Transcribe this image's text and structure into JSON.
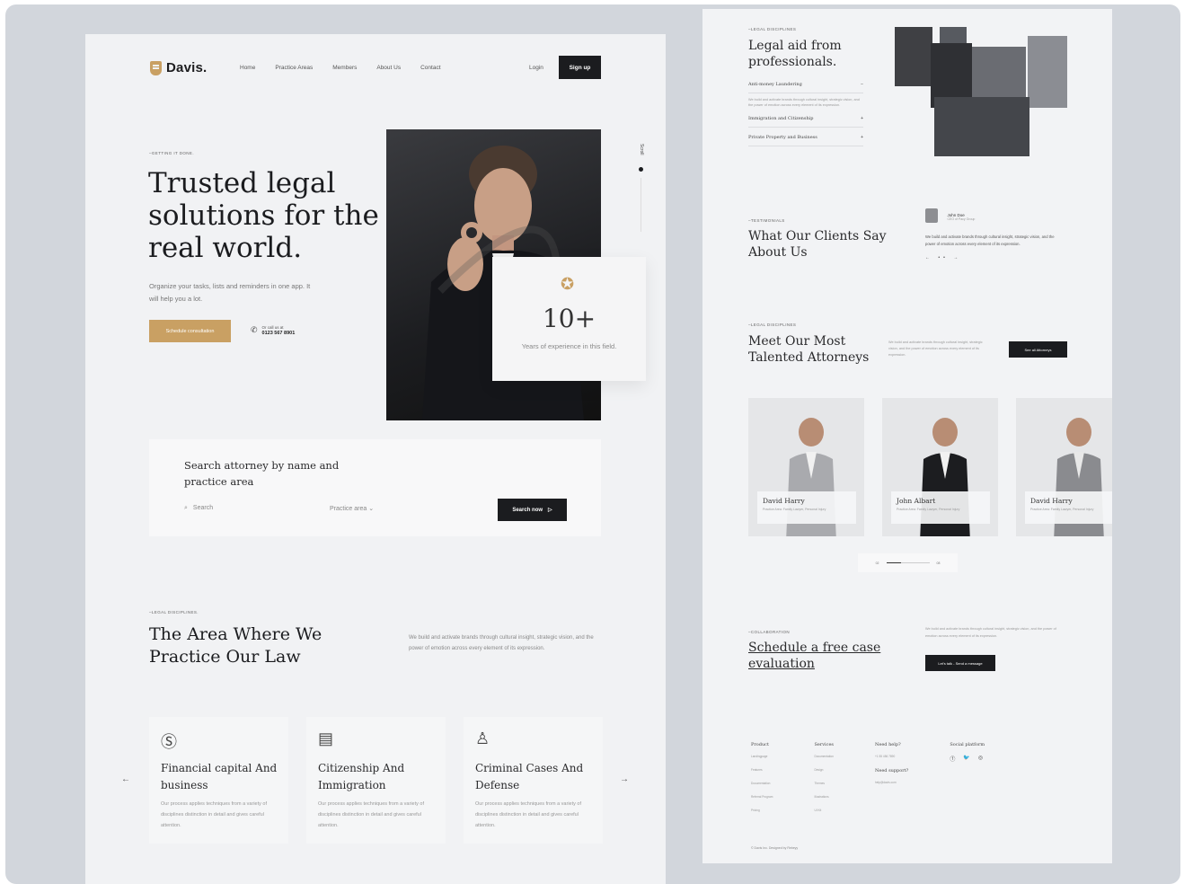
{
  "left": {
    "logo": "Davis.",
    "nav": [
      "Home",
      "Practice Areas",
      "Members",
      "About Us",
      "Contact"
    ],
    "login": "Login",
    "signup": "Sign up",
    "hero": {
      "eyebrow": "–GETTING IT DONE.",
      "title": "Trusted legal solutions for the real world.",
      "desc": "Organize your tasks, lists and reminders in one app. It will help you a lot.",
      "cta": "Schedule consultation",
      "call_label": "Or call us at",
      "call_number": "0123 567 8901",
      "scroll": "Scroll"
    },
    "experience": {
      "number": "10+",
      "label": "Years of experience in this field."
    },
    "search": {
      "title": "Search attorney by name and practice area",
      "placeholder": "Search",
      "area": "Practice area",
      "button": "Search now"
    },
    "practice": {
      "eyebrow": "–LEGAL DISCIPLINES.",
      "title": "The Area Where We Practice Our Law",
      "desc": "We build and activate brands through cultural insight, strategic vision, and the power of emotion across every element of its expression.",
      "cards": [
        {
          "icon": "dollar-icon",
          "title": "Financial capital And business",
          "desc": "Our process applies techniques from a variety of disciplines distinction in detail and gives careful attention."
        },
        {
          "icon": "passport-icon",
          "title": "Citizenship And Immigration",
          "desc": "Our process applies techniques from a variety of disciplines distinction in detail and gives careful attention."
        },
        {
          "icon": "user-shield-icon",
          "title": "Criminal Cases And Defense",
          "desc": "Our process applies techniques from a variety of disciplines distinction in detail and gives careful attention."
        }
      ]
    }
  },
  "right": {
    "legal_aid": {
      "eyebrow": "–LEGAL DISCIPLINES",
      "title": "Legal aid from professionals.",
      "items": [
        {
          "label": "Anti-money Laundering",
          "symbol": "−",
          "sub": "We build and activate brands through cultural insight, strategic vision, and the power of emotion across every element of its expression."
        },
        {
          "label": "Immigration and Citizenship",
          "symbol": "+"
        },
        {
          "label": "Private Property and Business",
          "symbol": "+"
        }
      ]
    },
    "testimonials": {
      "eyebrow": "–TESTIMONIALS",
      "title": "What Our Clients Say About Us",
      "name": "John Doe",
      "role": "CEO of Pacy Group",
      "quote": "We build and activate brands through cultural insight, strategic vision, and the power of emotion across every element of its expression.",
      "pager": "← •• →"
    },
    "attorneys": {
      "eyebrow": "–LEGAL DISCIPLINES",
      "title": "Meet Our Most Talented Attorneys",
      "desc": "We build and activate brands through cultural insight, strategic vision, and the power of emotion across every element of its expression.",
      "button": "See all Attorneys",
      "items": [
        {
          "name": "David Harry",
          "role": "Practice Area: Family Lawyer, Personal Injury"
        },
        {
          "name": "John Albart",
          "role": "Practice Area: Family Lawyer, Personal Injury"
        },
        {
          "name": "David Harry",
          "role": "Practice Area: Family Lawyer, Personal Injury"
        }
      ],
      "slider_start": "02",
      "slider_end": "08"
    },
    "evaluation": {
      "eyebrow": "–COLLABORATION",
      "title": "Schedule a free case evaluation",
      "desc": "We build and activate brands through cultural insight, strategic vision, and the power of emotion across every element of its expression.",
      "button": "Let's talk - Send a message"
    },
    "footer": {
      "cols": [
        {
          "title": "Product",
          "items": [
            "Landingpage",
            "Features",
            "Documentation",
            "Referral Program",
            "Pricing"
          ]
        },
        {
          "title": "Services",
          "items": [
            "Documentation",
            "Design",
            "Themes",
            "Illustrations",
            "UI Kit"
          ]
        },
        {
          "title": "Need help?",
          "items": [
            "+1 55 456 7890"
          ],
          "title2": "Need support?",
          "items2": [
            "help@davis.com"
          ]
        },
        {
          "title": "Social platform",
          "icons": [
            "facebook-icon",
            "twitter-icon",
            "instagram-icon"
          ]
        }
      ],
      "copyright": "© Davis Inc. Designed by Rebeyy"
    }
  }
}
